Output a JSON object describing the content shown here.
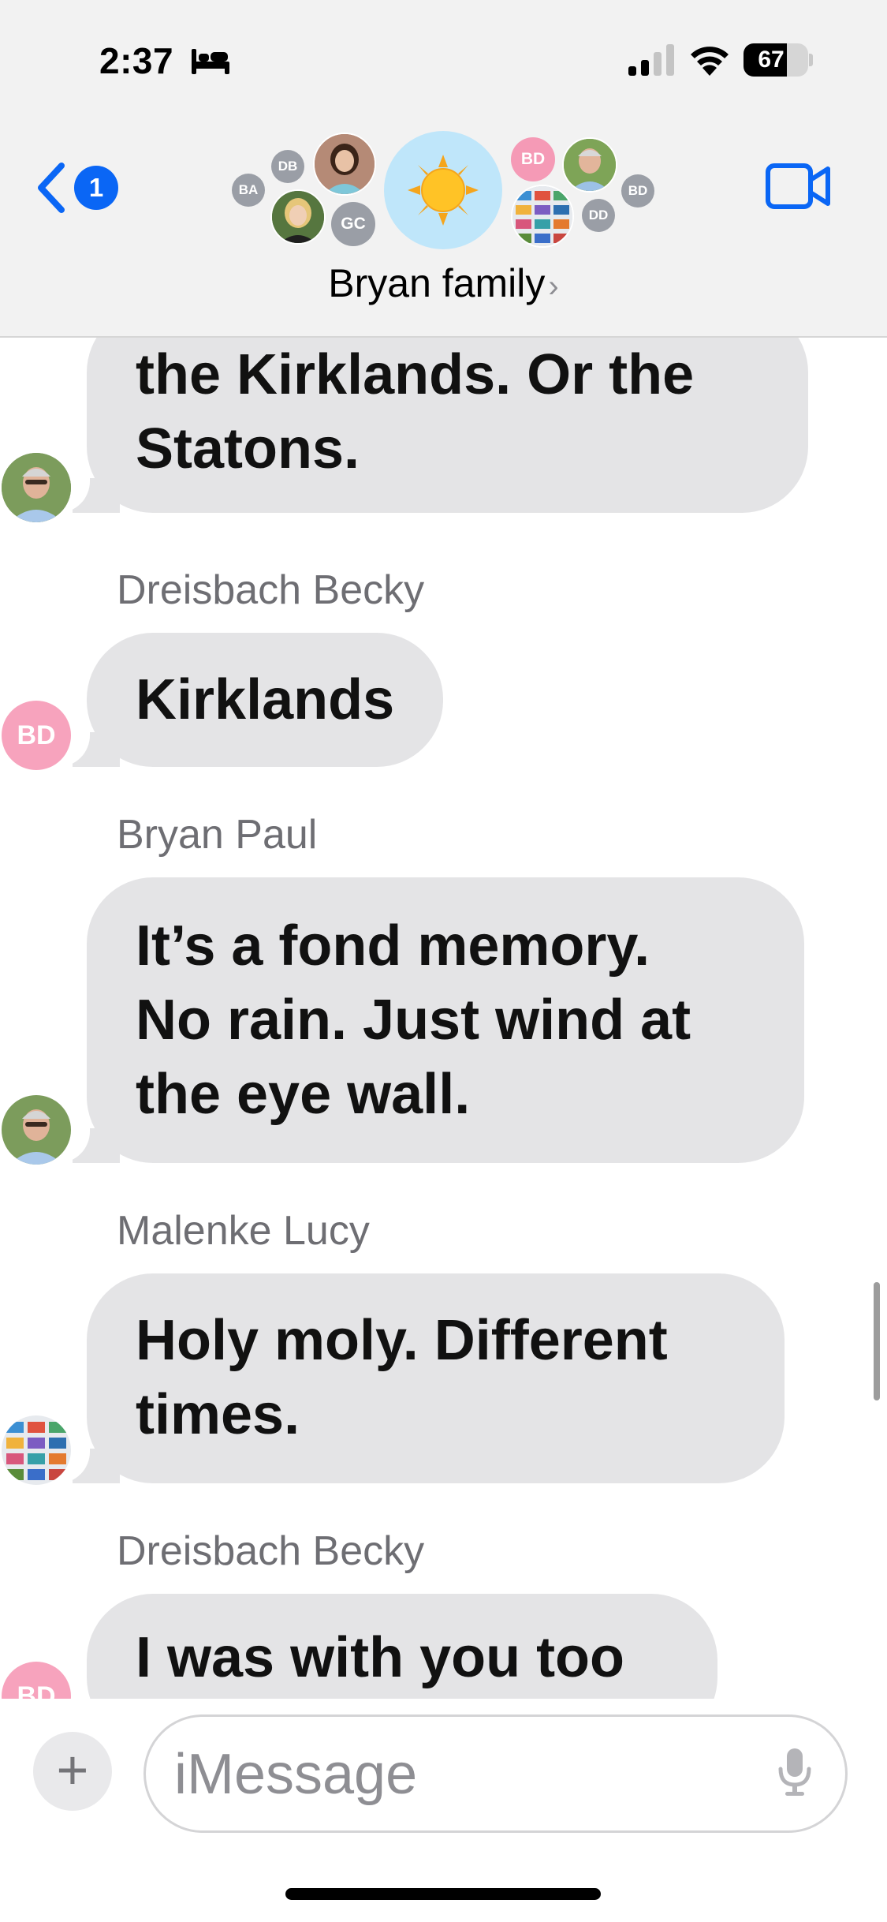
{
  "status_bar": {
    "time": "2:37",
    "battery_level": "67",
    "battery_fraction": 0.67
  },
  "header": {
    "back_badge_count": "1",
    "group_name": "Bryan family",
    "name_chevron": "›",
    "group_icon": "sun-emoji",
    "members": [
      {
        "initials": "DB",
        "kind": "gray"
      },
      {
        "initials": "BA",
        "kind": "gray"
      },
      {
        "initials": "GC",
        "kind": "gray"
      },
      {
        "initials": "BD",
        "kind": "pink"
      },
      {
        "initials": "DD",
        "kind": "gray"
      },
      {
        "initials": "BD",
        "kind": "gray"
      }
    ]
  },
  "messages": [
    {
      "sender": "",
      "lines": [
        "the Kirklands. Or the",
        "Statons."
      ],
      "avatar": "photo-man"
    },
    {
      "sender": "Dreisbach Becky",
      "lines": [
        "Kirklands"
      ],
      "avatar_initials": "BD"
    },
    {
      "sender": "Bryan Paul",
      "lines": [
        "It’s a fond memory.",
        "No rain. Just wind at",
        "the eye wall."
      ],
      "avatar": "photo-man"
    },
    {
      "sender": "Malenke Lucy",
      "lines": [
        "Holy moly. Different",
        "times."
      ],
      "avatar": "photo-collage"
    },
    {
      "sender": "Dreisbach Becky",
      "lines": [
        "I was with you too"
      ],
      "avatar_initials": "BD"
    }
  ],
  "composer": {
    "plus_label": "+",
    "placeholder": "iMessage"
  },
  "colors": {
    "accent": "#0a66f5",
    "bubble": "#e4e4e6",
    "header_bg": "#f2f2f2",
    "initials_pink": "#f7a3bd",
    "sender_gray": "#6e6e73"
  }
}
